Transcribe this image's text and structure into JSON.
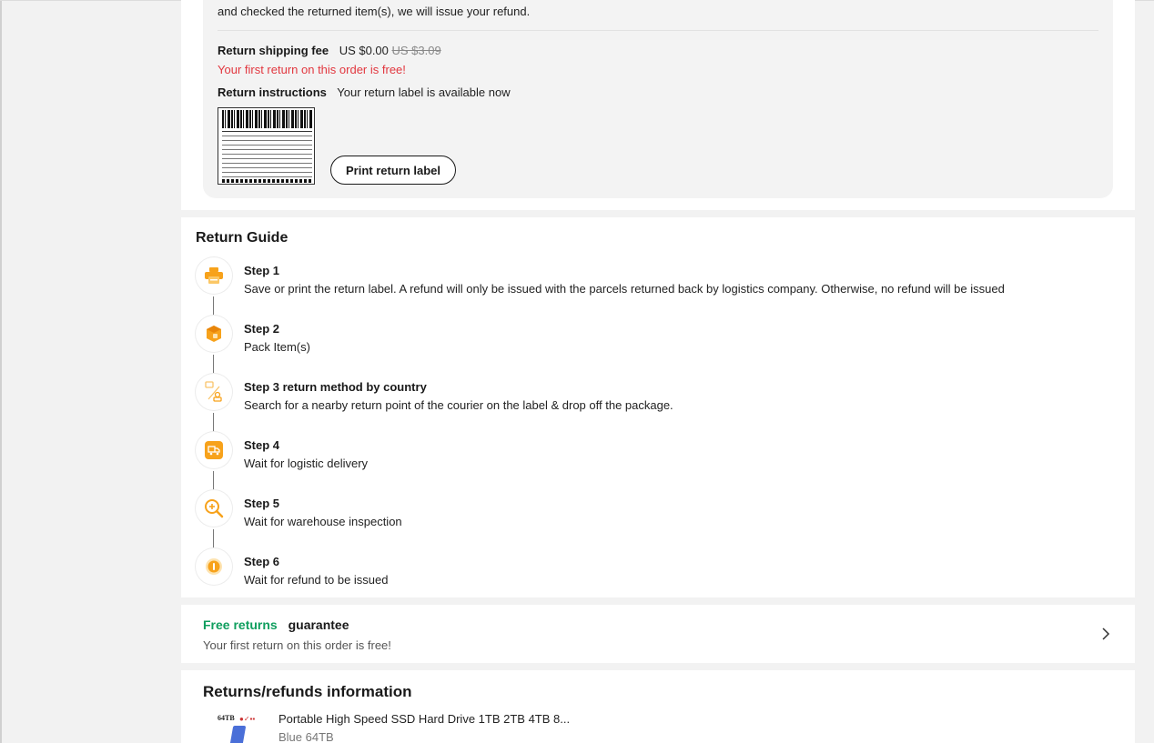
{
  "return_details": {
    "intro_text": "and checked the returned item(s), we will issue your refund.",
    "shipping_fee_label": "Return shipping fee",
    "shipping_fee_value": "US $0.00",
    "shipping_fee_original": "US $3.09",
    "free_note": "Your first return on this order is free!",
    "instructions_label": "Return instructions",
    "instructions_value": "Your return label is available now",
    "print_button_label": "Print return label"
  },
  "guide": {
    "title": "Return Guide",
    "steps": [
      {
        "title": "Step 1",
        "desc": "Save or print the return label. A refund will only be issued with the parcels returned back by logistics company. Otherwise, no refund will be issued",
        "icon": "printer-icon"
      },
      {
        "title": "Step 2",
        "desc": "Pack Item(s)",
        "icon": "package-icon"
      },
      {
        "title": "Step 3 return method by country",
        "desc": "Search for a nearby return point of the courier on the label & drop off the package.",
        "icon": "drop-off-icon"
      },
      {
        "title": "Step 4",
        "desc": "Wait for logistic delivery",
        "icon": "delivery-truck-icon"
      },
      {
        "title": "Step 5",
        "desc": "Wait for warehouse inspection",
        "icon": "inspection-magnifier-icon"
      },
      {
        "title": "Step 6",
        "desc": "Wait for refund to be issued",
        "icon": "refund-coin-icon"
      }
    ]
  },
  "free_returns": {
    "title_highlight": "Free returns",
    "title_rest": "guarantee",
    "subtitle": "Your first return on this order is free!"
  },
  "returns_info": {
    "title": "Returns/refunds information",
    "product": {
      "thumb_text": "64TB",
      "name": "Portable High Speed SSD Hard Drive 1TB 2TB 4TB 8...",
      "variant": "Blue 64TB"
    }
  },
  "colors": {
    "accent_orange": "#f7a21b",
    "free_green": "#0f9e5e",
    "free_red": "#e2373f"
  }
}
